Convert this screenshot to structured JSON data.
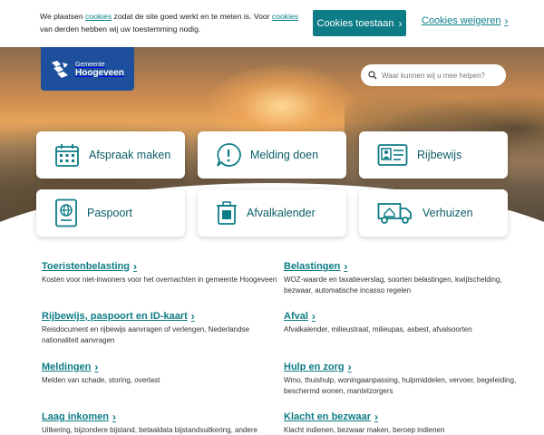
{
  "cookie": {
    "text_1": "We plaatsen ",
    "link_1": "cookies",
    "text_2": " zodat de site goed werkt en te meten is. Voor ",
    "link_2": "cookies",
    "text_3": " van derden hebben wij uw toestemming nodig.",
    "accept_label": "Cookies toestaan",
    "refuse_label": "Cookies weigeren"
  },
  "logo": {
    "line1": "Gemeente",
    "line2": "Hoogeveen"
  },
  "search": {
    "placeholder": "Waar kunnen wij u mee helpen?"
  },
  "tiles": [
    {
      "label": "Afspraak maken",
      "icon": "calendar-icon"
    },
    {
      "label": "Melding doen",
      "icon": "alert-bubble-icon"
    },
    {
      "label": "Rijbewijs",
      "icon": "id-card-icon"
    },
    {
      "label": "Paspoort",
      "icon": "passport-icon"
    },
    {
      "label": "Afvalkalender",
      "icon": "trash-bin-icon"
    },
    {
      "label": "Verhuizen",
      "icon": "moving-truck-icon"
    }
  ],
  "links": [
    {
      "title": "Toeristenbelasting",
      "desc": "Kosten voor niet-inwoners voor het overnachten in gemeente Hoogeveen"
    },
    {
      "title": "Belastingen",
      "desc": "WOZ-waarde en taxatieverslag, soorten belastingen, kwijtschelding, bezwaar, automatische incasso regelen"
    },
    {
      "title": "Rijbewijs, paspoort en ID-kaart",
      "desc": "Reisdocument en rijbewijs aanvragen of verlengen, Nederlandse nationaliteit aanvragen"
    },
    {
      "title": "Afval",
      "desc": "Afvalkalender, milieustraat, milieupas, asbest, afvalsoorten"
    },
    {
      "title": "Meldingen",
      "desc": "Melden van schade, storing, overlast"
    },
    {
      "title": "Hulp en zorg",
      "desc": "Wmo, thuishulp, woningaanpassing, hulpmiddelen, vervoer, begeleiding, beschermd wonen, mantelzorgers"
    },
    {
      "title": "Laag inkomen",
      "desc": "Uitkering, bijzondere bijstand, betaaldata bijstandsuitkering, andere"
    },
    {
      "title": "Klacht en bezwaar",
      "desc": "Klacht indienen, bezwaar maken, beroep indienen"
    }
  ],
  "colors": {
    "accent": "#0e7c86",
    "brand": "#1d4f9c"
  }
}
